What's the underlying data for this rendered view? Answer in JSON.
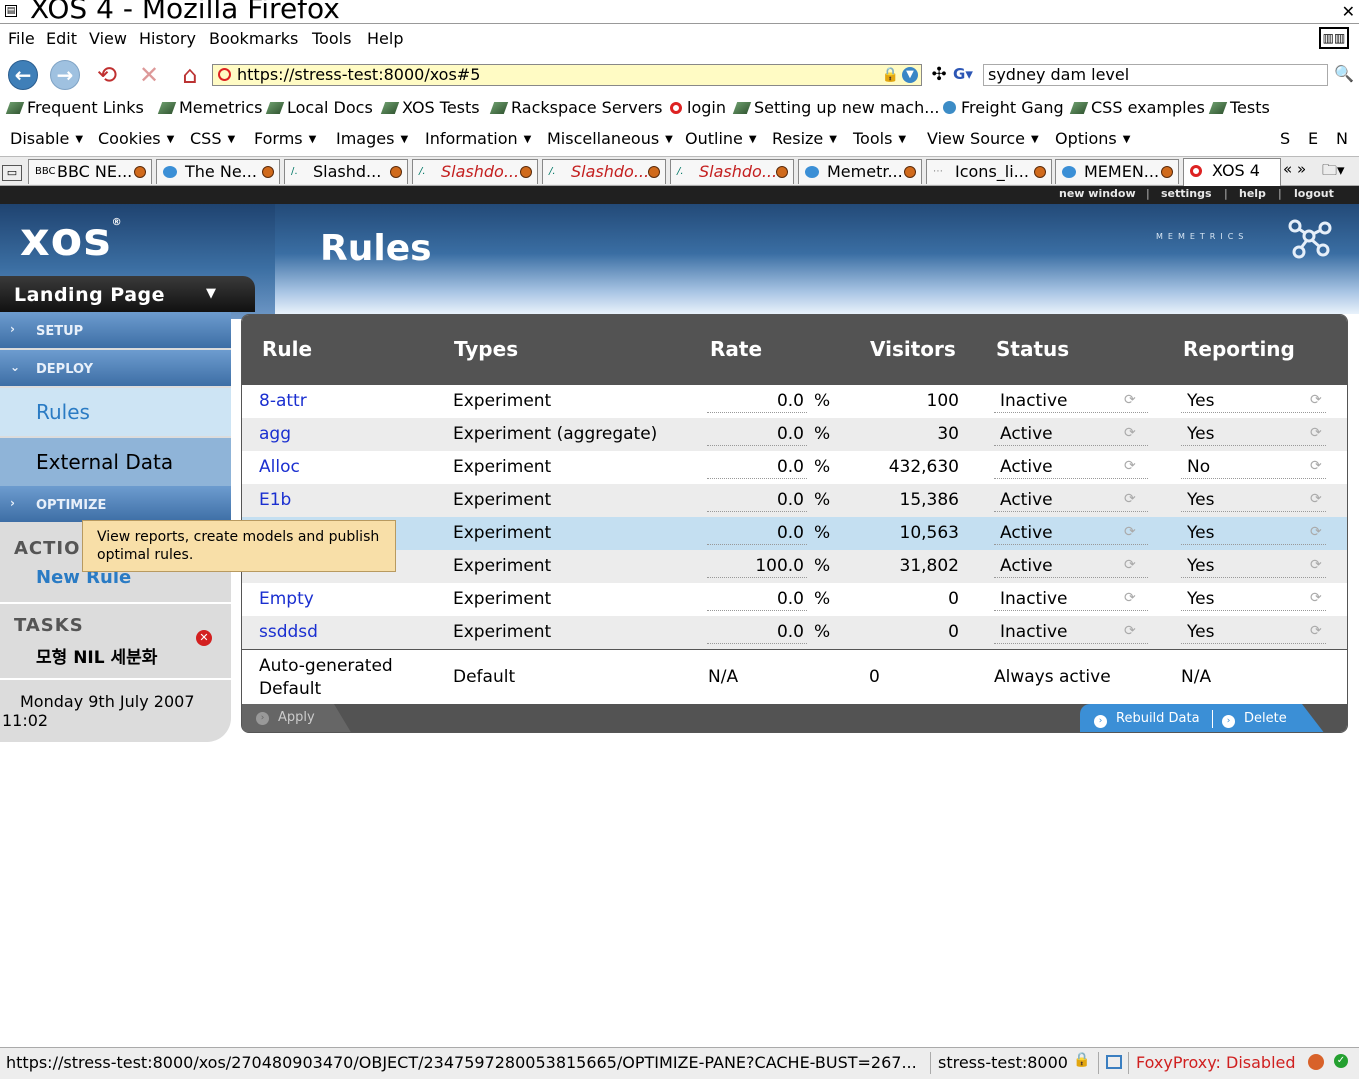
{
  "window": {
    "title": "XOS 4 - Mozilla Firefox"
  },
  "menubar": {
    "items": [
      "File",
      "Edit",
      "View",
      "History",
      "Bookmarks",
      "Tools",
      "Help"
    ]
  },
  "navbar": {
    "url": "https://stress-test:8000/xos#5",
    "search_value": "sydney dam level",
    "search_engine": "G"
  },
  "bookmarks": [
    "Frequent  Links",
    "Memetrics",
    "Local Docs",
    "XOS Tests",
    "Rackspace Servers",
    "login",
    "Setting up new mach...",
    "Freight Gang",
    "CSS examples",
    "Tests"
  ],
  "devbar": {
    "items": [
      "Disable",
      "Cookies",
      "CSS",
      "Forms",
      "Images",
      "Information",
      "Miscellaneous",
      "Outline",
      "Resize",
      "Tools",
      "View Source",
      "Options"
    ],
    "right": [
      "S",
      "E",
      "N"
    ]
  },
  "tabs": [
    {
      "label": "BBC NE...",
      "icon": "BBC"
    },
    {
      "label": "The Ne..."
    },
    {
      "label": "Slashd..."
    },
    {
      "label": "Slashdo..."
    },
    {
      "label": "Slashdo..."
    },
    {
      "label": "Slashdo..."
    },
    {
      "label": "Memetr..."
    },
    {
      "label": "Icons_li..."
    },
    {
      "label": "MEMEN..."
    },
    {
      "label": "XOS 4"
    }
  ],
  "tab_scroll": "«  »",
  "topnav": {
    "new_window": "new window",
    "settings": "settings",
    "help": "help",
    "logout": "logout",
    "sep": "|"
  },
  "header": {
    "logo": "xos",
    "title": "Rules",
    "brand": "MEMETRICS",
    "landing": "Landing Page"
  },
  "sidebar": {
    "setup": "SETUP",
    "deploy": "DEPLOY",
    "rules": "Rules",
    "external_data": "External Data",
    "optimize": "OPTIMIZE",
    "actions": "ACTIO",
    "new_rule": "New Rule",
    "tasks": "TASKS",
    "task_item": "모형 NIL 세분화",
    "date": "Monday 9th July 2007",
    "time": "11:02"
  },
  "tooltip": "View reports, create models and publish optimal rules.",
  "table": {
    "headers": {
      "rule": "Rule",
      "types": "Types",
      "rate": "Rate",
      "visitors": "Visitors",
      "status": "Status",
      "reporting": "Reporting"
    },
    "percent": "%",
    "rows": [
      {
        "rule": "8-attr",
        "type": "Experiment",
        "rate": "0.0",
        "visitors": "100",
        "status": "Inactive",
        "reporting": "Yes"
      },
      {
        "rule": "agg",
        "type": "Experiment (aggregate)",
        "rate": "0.0",
        "visitors": "30",
        "status": "Active",
        "reporting": "Yes"
      },
      {
        "rule": "Alloc",
        "type": "Experiment",
        "rate": "0.0",
        "visitors": "432,630",
        "status": "Active",
        "reporting": "No"
      },
      {
        "rule": "E1b",
        "type": "Experiment",
        "rate": "0.0",
        "visitors": "15,386",
        "status": "Active",
        "reporting": "Yes"
      },
      {
        "rule": "",
        "type": "Experiment",
        "rate": "0.0",
        "visitors": "10,563",
        "status": "Active",
        "reporting": "Yes"
      },
      {
        "rule": "",
        "type": "Experiment",
        "rate": "100.0",
        "visitors": "31,802",
        "status": "Active",
        "reporting": "Yes"
      },
      {
        "rule": "Empty",
        "type": "Experiment",
        "rate": "0.0",
        "visitors": "0",
        "status": "Inactive",
        "reporting": "Yes"
      },
      {
        "rule": "ssddsd",
        "type": "Experiment",
        "rate": "0.0",
        "visitors": "0",
        "status": "Inactive",
        "reporting": "Yes"
      }
    ],
    "default_row": {
      "rule_line1": "Auto-generated",
      "rule_line2": "Default",
      "type": "Default",
      "rate": "N/A",
      "visitors": "0",
      "status": "Always active",
      "reporting": "N/A"
    },
    "footer": {
      "apply": "Apply",
      "rebuild": "Rebuild Data",
      "delete": "Delete"
    }
  },
  "statusbar": {
    "url": "https://stress-test:8000/xos/270480903470/OBJECT/2347597280053815665/OPTIMIZE-PANE?CACHE-BUST=267...",
    "host": "stress-test:8000",
    "foxyproxy": "FoxyProxy: Disabled"
  }
}
